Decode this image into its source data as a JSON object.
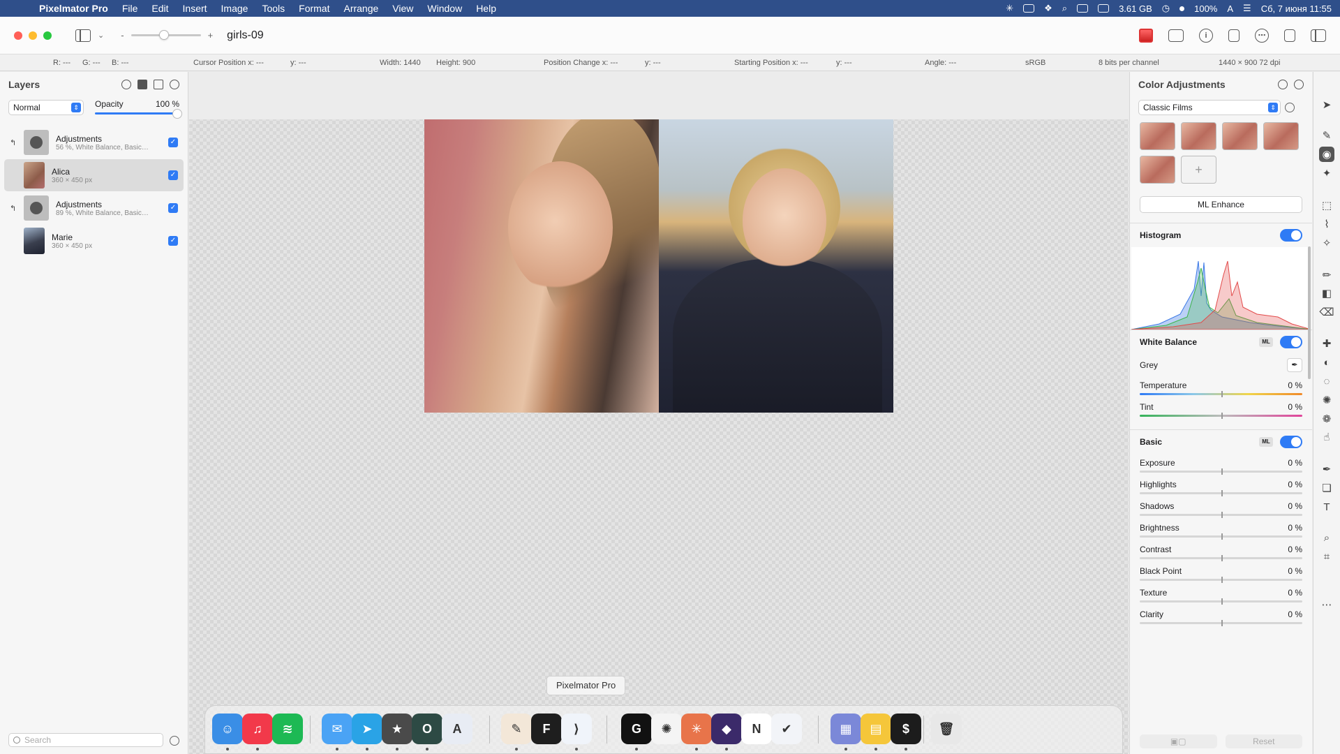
{
  "menubar": {
    "app_name": "Pixelmator Pro",
    "items": [
      "File",
      "Edit",
      "Insert",
      "Image",
      "Tools",
      "Format",
      "Arrange",
      "View",
      "Window",
      "Help"
    ],
    "memory": "3.61 GB",
    "battery": "100%",
    "input_lang": "A",
    "datetime": "Сб, 7 июня  11:55"
  },
  "window": {
    "title": "girls-09",
    "zoom_minus": "-",
    "zoom_plus": "+"
  },
  "infobar": {
    "r": "R: ---",
    "g": "G: ---",
    "b": "B: ---",
    "cursor_x": "Cursor Position x: ---",
    "cursor_y": "y: ---",
    "width": "Width: 1440",
    "height": "Height: 900",
    "change_x": "Position Change x: ---",
    "change_y": "y: ---",
    "start_x": "Starting Position x: ---",
    "start_y": "y: ---",
    "angle": "Angle: ---",
    "profile": "sRGB",
    "depth": "8 bits per channel",
    "size": "1440 × 900 72 dpi"
  },
  "layers": {
    "title": "Layers",
    "blend_mode": "Normal",
    "opacity_label": "Opacity",
    "opacity_value": "100 %",
    "items": [
      {
        "name": "Adjustments",
        "sub": "56 %, White Balance, Basic…",
        "clip": "↰"
      },
      {
        "name": "Alica",
        "sub": "360 × 450 px"
      },
      {
        "name": "Adjustments",
        "sub": "89 %, White Balance, Basic…",
        "clip": "↰"
      },
      {
        "name": "Marie",
        "sub": "360 × 450 px"
      }
    ],
    "search_placeholder": "Search"
  },
  "canvas": {
    "tooltip": "Pixelmator Pro"
  },
  "dock": {
    "apps": [
      {
        "name": "Finder",
        "color": "#3a8ee6",
        "glyph": "☺"
      },
      {
        "name": "Music",
        "color": "#f2394a",
        "glyph": "♫"
      },
      {
        "name": "Spotify",
        "color": "#1db954",
        "glyph": "≋"
      },
      {
        "name": "Mail",
        "color": "#4aa3f5",
        "glyph": "✉"
      },
      {
        "name": "Telegram",
        "color": "#2aa3e6",
        "glyph": "➤"
      },
      {
        "name": "Reeder",
        "color": "#4a4a4a",
        "glyph": "★"
      },
      {
        "name": "Opera",
        "color": "#2d4a44",
        "glyph": "O"
      },
      {
        "name": "Affinity",
        "color": "#e8ecf4",
        "glyph": "A"
      },
      {
        "name": "Pixelmator Pro",
        "color": "#f3e7d8",
        "glyph": "✎"
      },
      {
        "name": "Figma",
        "color": "#1e1e1e",
        "glyph": "F"
      },
      {
        "name": "VS Code",
        "color": "#f0f4fa",
        "glyph": "⟩"
      },
      {
        "name": "Grammarly",
        "color": "#111111",
        "glyph": "G"
      },
      {
        "name": "ChatGPT",
        "color": "#f4f4f4",
        "glyph": "✺"
      },
      {
        "name": "Claude",
        "color": "#e8744a",
        "glyph": "✳"
      },
      {
        "name": "Obsidian",
        "color": "#3b2a6a",
        "glyph": "◆"
      },
      {
        "name": "Notion",
        "color": "#ffffff",
        "glyph": "N"
      },
      {
        "name": "Things",
        "color": "#f2f4f8",
        "glyph": "✔"
      },
      {
        "name": "Archive",
        "color": "#7b88d8",
        "glyph": "▦"
      },
      {
        "name": "Unarchiver",
        "color": "#f5c63a",
        "glyph": "▤"
      },
      {
        "name": "Terminal",
        "color": "#1c1c1c",
        "glyph": "$"
      },
      {
        "name": "Trash",
        "color": "#e8e8e8",
        "glyph": "🗑"
      }
    ]
  },
  "adjust": {
    "title": "Color Adjustments",
    "preset": "Classic Films",
    "ml_enhance": "ML Enhance",
    "histogram": "Histogram",
    "white_balance": "White Balance",
    "ml_badge": "ML",
    "grey": "Grey",
    "wb_rows": [
      {
        "label": "Temperature",
        "value": "0 %"
      },
      {
        "label": "Tint",
        "value": "0 %"
      }
    ],
    "basic": "Basic",
    "basic_rows": [
      {
        "label": "Exposure",
        "value": "0 %"
      },
      {
        "label": "Highlights",
        "value": "0 %"
      },
      {
        "label": "Shadows",
        "value": "0 %"
      },
      {
        "label": "Brightness",
        "value": "0 %"
      },
      {
        "label": "Contrast",
        "value": "0 %"
      },
      {
        "label": "Black Point",
        "value": "0 %"
      },
      {
        "label": "Texture",
        "value": "0 %"
      },
      {
        "label": "Clarity",
        "value": "0 %"
      }
    ],
    "reset": "Reset"
  }
}
